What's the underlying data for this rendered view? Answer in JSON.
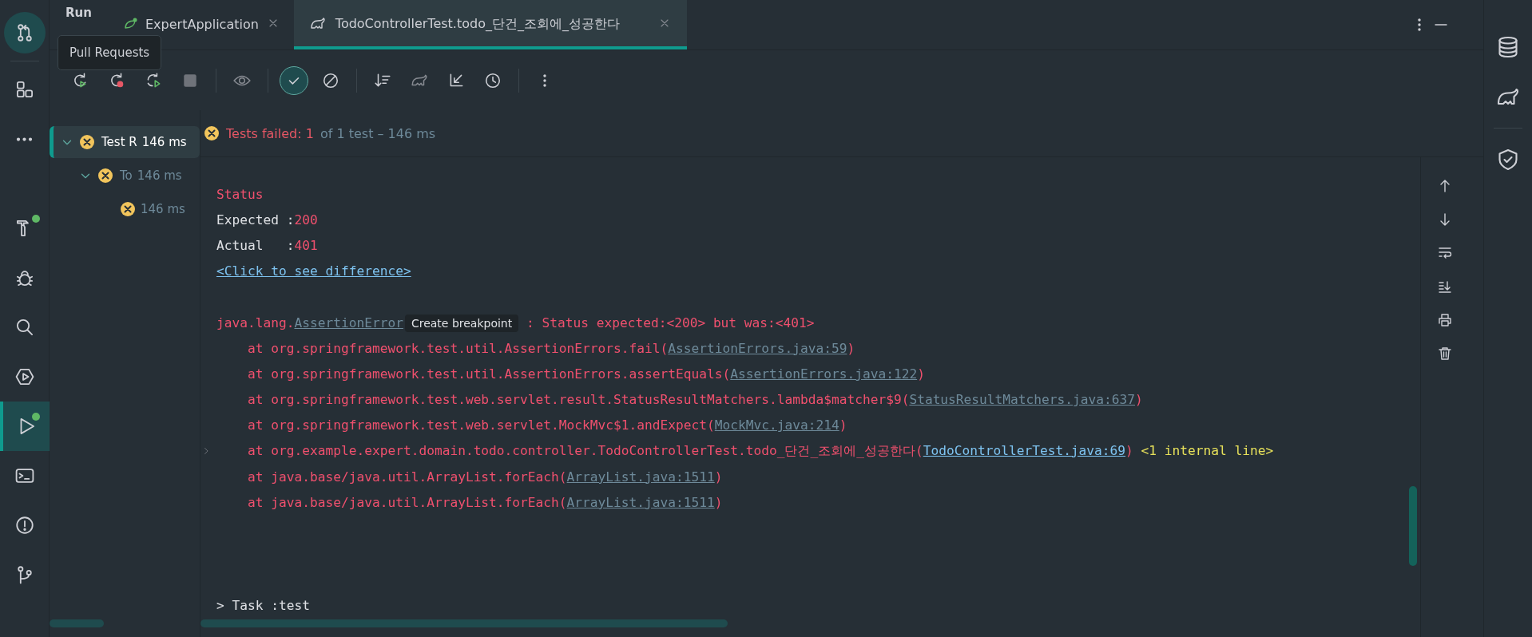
{
  "left_toolbar": [
    {
      "kind": "pull-requests",
      "selected": true,
      "badge": false
    },
    {
      "kind": "structure",
      "selected": false,
      "badge": false
    },
    {
      "kind": "more",
      "selected": false,
      "badge": false
    },
    {
      "kind": "build",
      "selected": false,
      "badge": true
    },
    {
      "kind": "debug",
      "selected": false,
      "badge": false
    },
    {
      "kind": "search",
      "selected": false,
      "badge": false
    },
    {
      "kind": "services",
      "selected": false,
      "badge": false
    },
    {
      "kind": "run",
      "selected": true,
      "badge": true
    },
    {
      "kind": "terminal",
      "selected": false,
      "badge": false
    },
    {
      "kind": "problems",
      "selected": false,
      "badge": false
    },
    {
      "kind": "git",
      "selected": false,
      "badge": false
    }
  ],
  "tooltip": "Pull Requests",
  "tool_window_title": "Run",
  "tabs": [
    {
      "label": "ExpertApplication",
      "kind": "app",
      "selected": false
    },
    {
      "label": "TodoControllerTest.todo_단건_조회에_성공한다",
      "kind": "gradle",
      "selected": true
    }
  ],
  "toolbar": [
    {
      "kind": "rerun",
      "selected": false
    },
    {
      "kind": "rerun-failed",
      "selected": false
    },
    {
      "kind": "rerun-toggle",
      "selected": false
    },
    {
      "kind": "stop",
      "selected": false
    },
    {
      "kind": "eye",
      "selected": false
    },
    {
      "kind": "check",
      "selected": true
    },
    {
      "kind": "cancel",
      "selected": false
    },
    {
      "kind": "sort",
      "selected": false
    },
    {
      "kind": "gradle",
      "selected": false
    },
    {
      "kind": "collapse",
      "selected": false
    },
    {
      "kind": "history",
      "selected": false
    },
    {
      "kind": "dots",
      "selected": false
    }
  ],
  "tree": [
    {
      "label": "Test R",
      "time": "146 ms",
      "expanded": true,
      "selected": true,
      "children": [
        {
          "label": "To",
          "time": "146 ms",
          "expanded": true,
          "selected": false,
          "children": [
            {
              "time": "146 ms",
              "selected": false
            }
          ]
        }
      ]
    }
  ],
  "summary": {
    "failed": "Tests failed: 1",
    "detail": "of 1 test – 146 ms"
  },
  "console": [
    {
      "kind": "text",
      "indent": false,
      "segments": [
        {
          "kind": "error",
          "text": "Status"
        }
      ]
    },
    {
      "kind": "text",
      "indent": false,
      "segments": [
        {
          "kind": "plain",
          "text": "Expected :"
        },
        {
          "kind": "error",
          "text": "200"
        }
      ]
    },
    {
      "kind": "text",
      "indent": false,
      "segments": [
        {
          "kind": "plain",
          "text": "Actual   :"
        },
        {
          "kind": "error",
          "text": "401"
        }
      ]
    },
    {
      "kind": "text",
      "indent": false,
      "segments": [
        {
          "kind": "link",
          "text": "<Click to see difference>"
        }
      ]
    },
    {
      "kind": "blank"
    },
    {
      "kind": "text",
      "indent": false,
      "segments": [
        {
          "kind": "error",
          "text": "java.lang."
        },
        {
          "kind": "source",
          "text": "AssertionError"
        },
        {
          "kind": "hint",
          "text": "Create breakpoint"
        },
        {
          "kind": "error",
          "text": " : Status expected:<200> but was:<401>"
        }
      ]
    },
    {
      "kind": "text",
      "indent": true,
      "segments": [
        {
          "kind": "error",
          "text": "at org.springframework.test.util.AssertionErrors.fail("
        },
        {
          "kind": "source",
          "text": "AssertionErrors.java:59"
        },
        {
          "kind": "error",
          "text": ")"
        }
      ]
    },
    {
      "kind": "text",
      "indent": true,
      "segments": [
        {
          "kind": "error",
          "text": "at org.springframework.test.util.AssertionErrors.assertEquals("
        },
        {
          "kind": "source",
          "text": "AssertionErrors.java:122"
        },
        {
          "kind": "error",
          "text": ")"
        }
      ]
    },
    {
      "kind": "text",
      "indent": true,
      "segments": [
        {
          "kind": "error",
          "text": "at org.springframework.test.web.servlet.result.StatusResultMatchers.lambda$matcher$9("
        },
        {
          "kind": "source",
          "text": "StatusResultMatchers.java:637"
        },
        {
          "kind": "error",
          "text": ")"
        }
      ]
    },
    {
      "kind": "text",
      "indent": true,
      "segments": [
        {
          "kind": "error",
          "text": "at org.springframework.test.web.servlet.MockMvc$1.andExpect("
        },
        {
          "kind": "source",
          "text": "MockMvc.java:214"
        },
        {
          "kind": "error",
          "text": ")"
        }
      ]
    },
    {
      "kind": "text",
      "indent": true,
      "fold": true,
      "segments": [
        {
          "kind": "error",
          "text": "at org.example.expert.domain.todo.controller.TodoControllerTest.todo_단건_조회에_성공한다("
        },
        {
          "kind": "link",
          "text": "TodoControllerTest.java:69"
        },
        {
          "kind": "error",
          "text": ")"
        },
        {
          "kind": "note",
          "text": " <1 internal line>"
        }
      ]
    },
    {
      "kind": "text",
      "indent": true,
      "segments": [
        {
          "kind": "error",
          "text": "at java.base/java.util.ArrayList.forEach("
        },
        {
          "kind": "source",
          "text": "ArrayList.java:1511"
        },
        {
          "kind": "error",
          "text": ")"
        }
      ]
    },
    {
      "kind": "text",
      "indent": true,
      "segments": [
        {
          "kind": "error",
          "text": "at java.base/java.util.ArrayList.forEach("
        },
        {
          "kind": "source",
          "text": "ArrayList.java:1511"
        },
        {
          "kind": "error",
          "text": ")"
        }
      ]
    },
    {
      "kind": "blank"
    },
    {
      "kind": "blank"
    },
    {
      "kind": "blank"
    },
    {
      "kind": "text",
      "indent": false,
      "segments": [
        {
          "kind": "plain",
          "text": "> Task :test"
        }
      ]
    }
  ],
  "console_actions": [
    {
      "kind": "up"
    },
    {
      "kind": "down"
    },
    {
      "kind": "wrap"
    },
    {
      "kind": "scroll-end"
    },
    {
      "kind": "print"
    },
    {
      "kind": "trash"
    }
  ],
  "right_toolbar": [
    {
      "kind": "database"
    },
    {
      "kind": "elephant"
    },
    {
      "kind": "divider"
    },
    {
      "kind": "shield"
    }
  ]
}
